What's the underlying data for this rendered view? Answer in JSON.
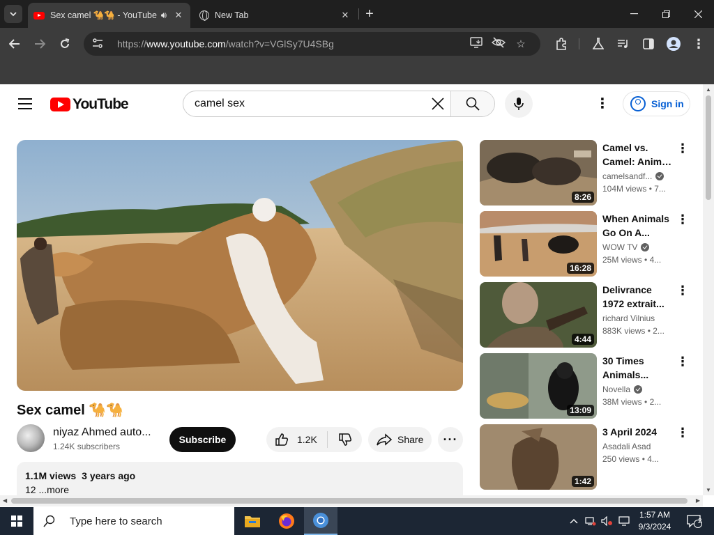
{
  "browser": {
    "tabs": [
      {
        "title": "Sex camel 🐪🐪 - YouTube",
        "active": true,
        "audio": true
      },
      {
        "title": "New Tab",
        "active": false
      }
    ],
    "url_prefix": "https://",
    "url_host": "www.youtube.com",
    "url_path": "/watch?v=VGlSy7U4SBg"
  },
  "youtube": {
    "logo_text": "YouTube",
    "search_query": "camel sex",
    "signin_label": "Sign in",
    "video": {
      "title": "Sex camel 🐪🐪",
      "channel": "niyaz Ahmed auto...",
      "subscribers": "1.24K subscribers",
      "subscribe_label": "Subscribe",
      "likes": "1.2K",
      "share_label": "Share",
      "views": "1.1M views",
      "age": "3 years ago",
      "desc_line": "12 ...more"
    },
    "recommendations": [
      {
        "title1": "Camel vs.",
        "title2": "Camel: Anima...",
        "channel": "camelsandf...",
        "verified": true,
        "views": "104M views",
        "age": "• 7...",
        "duration": "8:26"
      },
      {
        "title1": "When Animals",
        "title2": "Go On A...",
        "channel": "WOW TV",
        "verified": true,
        "views": "25M views",
        "age": "• 4...",
        "duration": "16:28"
      },
      {
        "title1": "Delivrance",
        "title2": "1972 extrait...",
        "channel": "richard Vilnius",
        "verified": false,
        "views": "883K views",
        "age": "• 2...",
        "duration": "4:44"
      },
      {
        "title1": "30 Times",
        "title2": "Animals...",
        "channel": "Novella",
        "verified": true,
        "views": "38M views",
        "age": "• 2...",
        "duration": "13:09"
      },
      {
        "title1": "3 April 2024",
        "title2": "",
        "channel": "Asadali Asad",
        "verified": false,
        "views": "250 views",
        "age": "• 4...",
        "duration": "1:42"
      }
    ]
  },
  "taskbar": {
    "search_placeholder": "Type here to search",
    "time": "1:57 AM",
    "date": "9/3/2024",
    "notifications": "2"
  },
  "colors": {
    "youtube_red": "#ff0000",
    "link_blue": "#065fd4",
    "chrome_dark": "#3c3c3c",
    "taskbar": "#1c2634"
  }
}
